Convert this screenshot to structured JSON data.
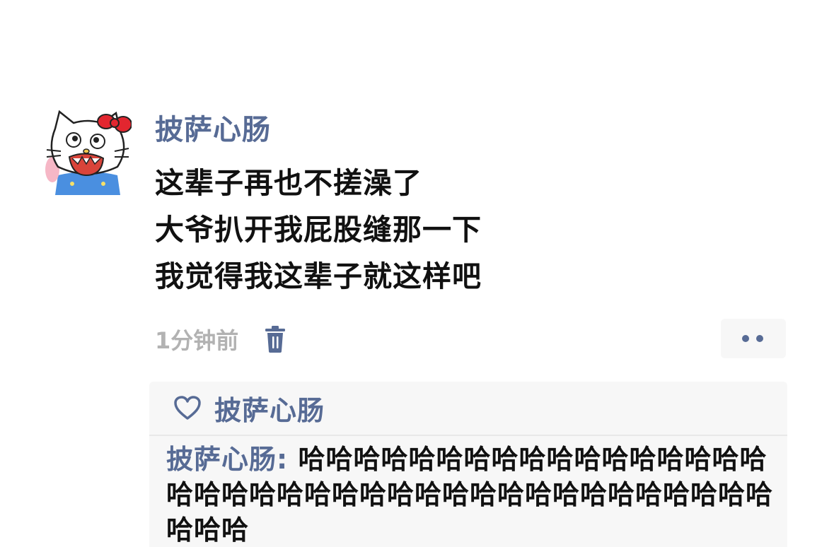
{
  "post": {
    "author": "披萨心肠",
    "lines": [
      "这辈子再也不搓澡了",
      "大爷扒开我屁股缝那一下",
      "我觉得我这辈子就这样吧"
    ],
    "time": "1分钟前"
  },
  "likes": {
    "names": "披萨心肠"
  },
  "comment": {
    "author": "披萨心肠",
    "separator": ": ",
    "text": "哈哈哈哈哈哈哈哈哈哈哈哈哈哈哈哈哈哈哈哈哈哈哈哈哈哈哈哈哈哈哈哈哈哈哈哈哈哈哈哈哈哈"
  },
  "icons": {
    "delete": "trash-icon",
    "more": "more-dots-icon",
    "like": "heart-icon"
  },
  "colors": {
    "name_blue": "#576b95",
    "time_gray": "#b2b2b2",
    "comment_bg": "#f7f7f7"
  }
}
